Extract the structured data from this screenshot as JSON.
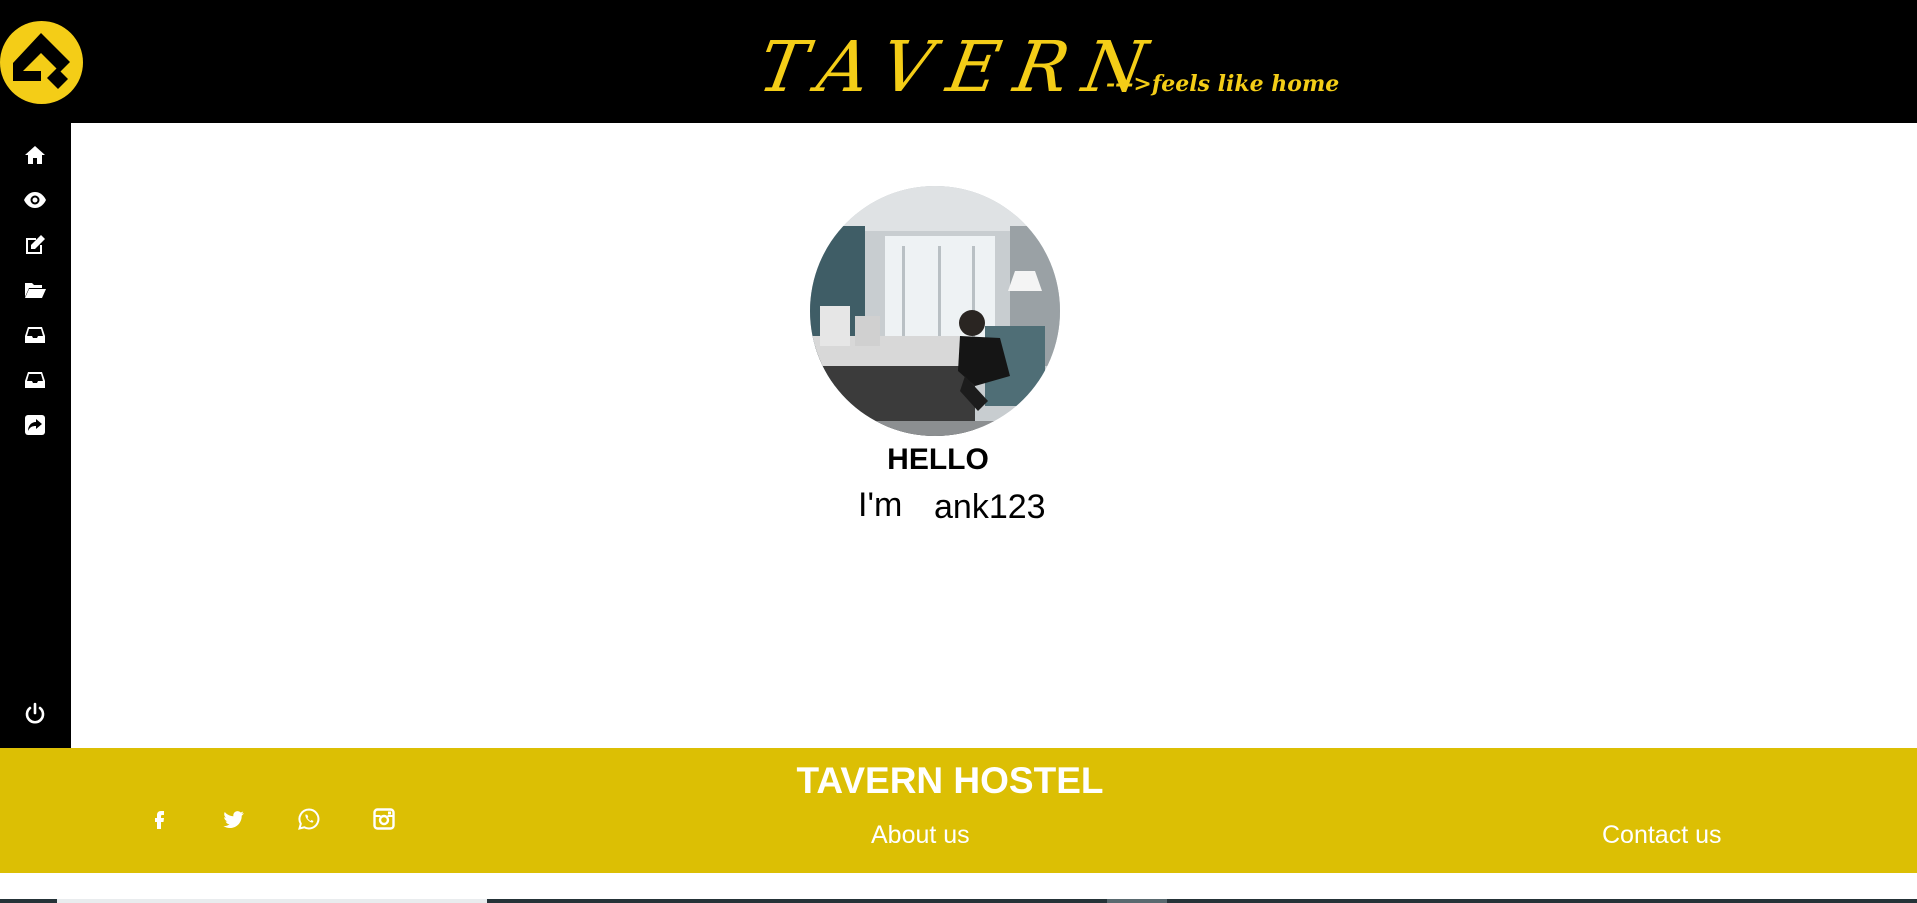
{
  "header": {
    "brand_title": "TAVERN",
    "tagline": "--->feels like home",
    "logo_icon": "tavern-logo-icon",
    "accent_color": "#f4cd17"
  },
  "sidebar": {
    "items": [
      {
        "icon": "home-icon"
      },
      {
        "icon": "eye-icon"
      },
      {
        "icon": "edit-icon"
      },
      {
        "icon": "folder-open-icon"
      },
      {
        "icon": "inbox-icon"
      },
      {
        "icon": "inbox-icon"
      },
      {
        "icon": "share-icon"
      }
    ],
    "logout_icon": "power-icon"
  },
  "profile": {
    "greeting": "HELLO",
    "intro": "I'm",
    "username": "ank123",
    "avatar_icon": "profile-photo"
  },
  "footer": {
    "title": "TAVERN HOSTEL",
    "about_label": "About us",
    "contact_label": "Contact us",
    "social_icons": [
      "facebook-icon",
      "twitter-icon",
      "whatsapp-icon",
      "instagram-icon"
    ],
    "background_color": "#dcbf04"
  }
}
